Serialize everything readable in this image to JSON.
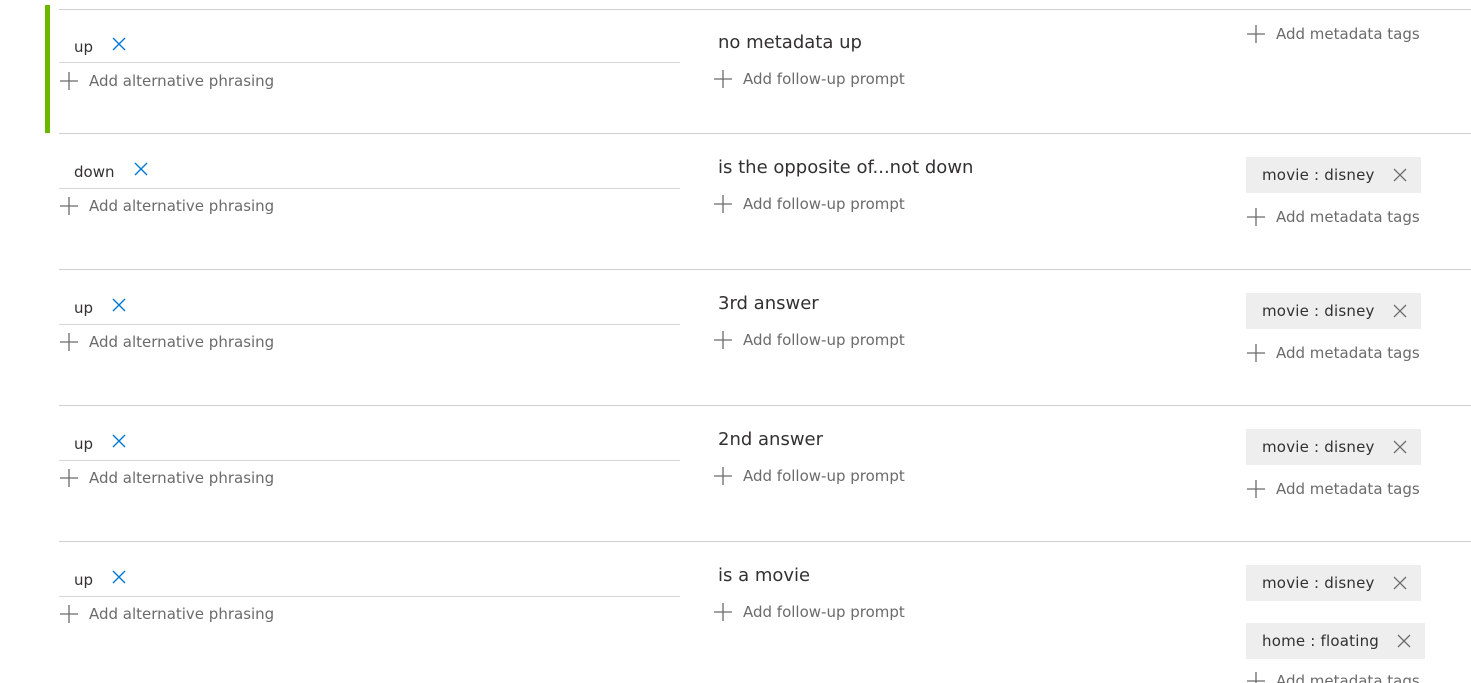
{
  "rows": [
    {
      "question": "up",
      "add_alt": "Add alternative phrasing",
      "answer": "no metadata up",
      "add_followup": "Add follow-up prompt",
      "tags": [],
      "add_meta": "Add metadata tags"
    },
    {
      "question": "down",
      "add_alt": "Add alternative phrasing",
      "answer": "is the opposite of...not down",
      "add_followup": "Add follow-up prompt",
      "tags": [
        "movie : disney"
      ],
      "add_meta": "Add metadata tags"
    },
    {
      "question": "up",
      "add_alt": "Add alternative phrasing",
      "answer": "3rd answer",
      "add_followup": "Add follow-up prompt",
      "tags": [
        "movie : disney"
      ],
      "add_meta": "Add metadata tags"
    },
    {
      "question": "up",
      "add_alt": "Add alternative phrasing",
      "answer": "2nd answer",
      "add_followup": "Add follow-up prompt",
      "tags": [
        "movie : disney"
      ],
      "add_meta": "Add metadata tags"
    },
    {
      "question": "up",
      "add_alt": "Add alternative phrasing",
      "answer": "is a movie",
      "add_followup": "Add follow-up prompt",
      "tags": [
        "movie : disney",
        "home : floating"
      ],
      "add_meta": "Add metadata tags"
    }
  ],
  "colors": {
    "selected_indicator": "#6bb700",
    "remove_question_x": "#0078d4",
    "tag_background": "#eeeeee"
  },
  "icons": {
    "remove_question": "close-icon",
    "add": "plus-icon",
    "remove_tag": "close-icon"
  }
}
